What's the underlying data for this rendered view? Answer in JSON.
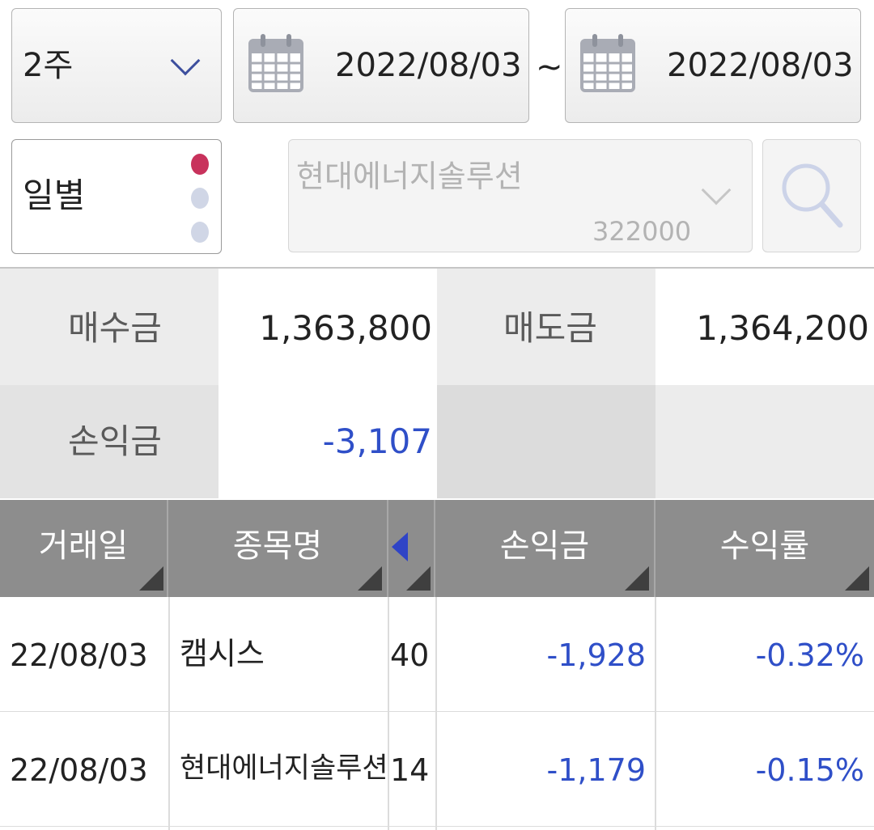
{
  "filters": {
    "period": "2주",
    "start_date": "2022/08/03",
    "tilde": "~",
    "end_date": "2022/08/03",
    "mode": "일별",
    "stock_name": "현대에너지솔루션",
    "stock_code": "322000"
  },
  "summary": {
    "buy_label": "매수금",
    "buy_value": "1,363,800",
    "sell_label": "매도금",
    "sell_value": "1,364,200",
    "pnl_label": "손익금",
    "pnl_value": "-3,107"
  },
  "table": {
    "headers": [
      "거래일",
      "종목명",
      "손익금",
      "수익률"
    ],
    "rows": [
      {
        "date": "22/08/03",
        "name": "캠시스",
        "qty": "40",
        "pnl": "-1,928",
        "rate": "-0.32%"
      },
      {
        "date": "22/08/03",
        "name": "현대에너지솔루션",
        "qty": "14",
        "pnl": "-1,179",
        "rate": "-0.15%"
      }
    ]
  },
  "colors": {
    "accent_blue": "#2f4fc8",
    "header_grey": "#8d8d8d",
    "dot_active": "#c8325c",
    "dot_inactive": "#d0d6e6"
  },
  "icons": {
    "calendar": "calendar-icon",
    "search": "search-icon",
    "dropdown": "chevron-down-icon",
    "scroll": "triangle-left-icon"
  }
}
